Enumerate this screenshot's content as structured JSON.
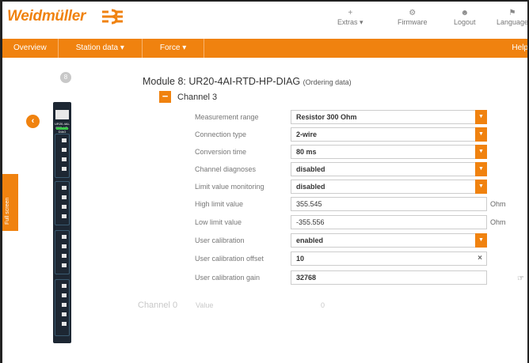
{
  "brand": {
    "name": "Weidmüller",
    "accent": "#f0820f"
  },
  "topnav": [
    {
      "label": "Extras",
      "icon": "plus-icon",
      "caret": "▾"
    },
    {
      "label": "Firmware",
      "icon": "gear-icon"
    },
    {
      "label": "Logout",
      "icon": "user-icon"
    },
    {
      "label": "Language",
      "icon": "flag-icon"
    }
  ],
  "nav": {
    "items": [
      "Overview",
      "Station data",
      "Force"
    ],
    "help": "Help"
  },
  "station": {
    "number": "8",
    "side_tab": "Full screen"
  },
  "module": {
    "label": "UR20-4AI-RTD-HP-DIAG",
    "title": "Module 8: UR20-4AI-RTD-HP-DIAG",
    "ordering_link": "(Ordering data)"
  },
  "channel": {
    "label": "Channel 3"
  },
  "fields": [
    {
      "label": "Measurement range",
      "value": "Resistor 300 Ohm",
      "type": "select"
    },
    {
      "label": "Connection type",
      "value": "2-wire",
      "type": "select"
    },
    {
      "label": "Conversion time",
      "value": "80 ms",
      "type": "select"
    },
    {
      "label": "Channel diagnoses",
      "value": "disabled",
      "type": "select"
    },
    {
      "label": "Limit value monitoring",
      "value": "disabled",
      "type": "select"
    },
    {
      "label": "High limit value",
      "value": "355.545",
      "type": "input",
      "unit": "Ohm"
    },
    {
      "label": "Low limit value",
      "value": "-355.556",
      "type": "input",
      "unit": "Ohm"
    },
    {
      "label": "User calibration",
      "value": "enabled",
      "type": "select"
    },
    {
      "label": "User calibration offset",
      "value": "10",
      "type": "input-clear"
    },
    {
      "label": "User calibration gain",
      "value": "32768",
      "type": "input"
    }
  ],
  "channel0": {
    "label": "Channel 0",
    "value_label": "Value",
    "value": "0"
  }
}
